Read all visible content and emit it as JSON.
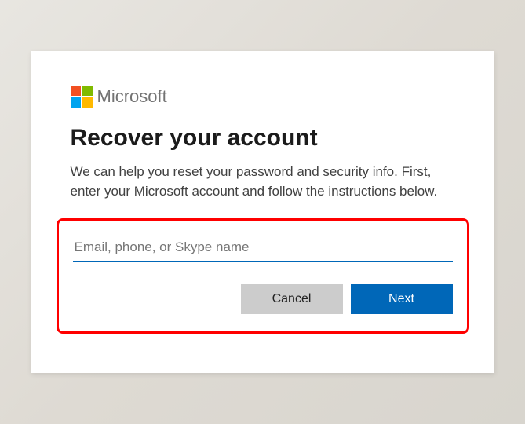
{
  "brand": {
    "name": "Microsoft"
  },
  "page": {
    "title": "Recover your account",
    "description": "We can help you reset your password and security info. First, enter your Microsoft account and follow the instructions below."
  },
  "form": {
    "account_placeholder": "Email, phone, or Skype name",
    "account_value": ""
  },
  "buttons": {
    "cancel": "Cancel",
    "next": "Next"
  },
  "colors": {
    "primary": "#0067b8",
    "highlight_border": "#ff0000",
    "cancel_bg": "#cccccc"
  }
}
